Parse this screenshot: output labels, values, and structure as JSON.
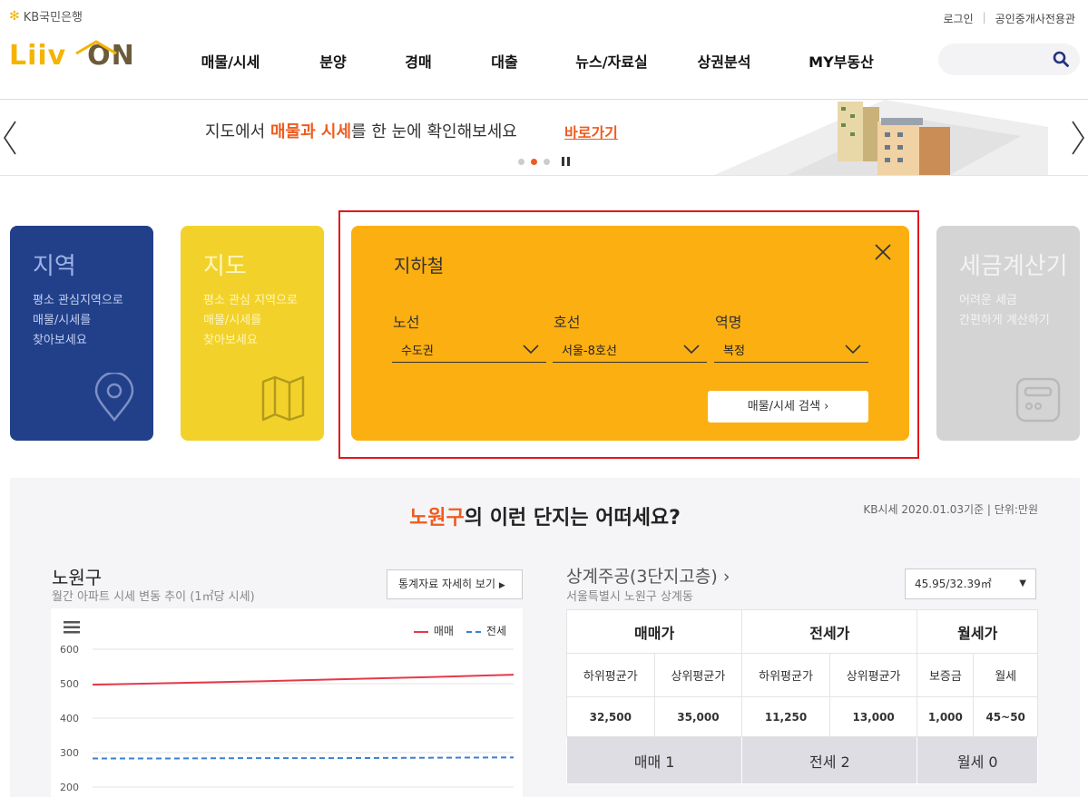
{
  "header": {
    "kb_brand": "KB국민은행",
    "logo_left": "Liiv",
    "logo_right": "ON",
    "login": "로그인",
    "agent": "공인중개사전용관",
    "nav": [
      "매물/시세",
      "분양",
      "경매",
      "대출",
      "뉴스/자료실",
      "상권분석",
      "MY부동산"
    ],
    "search": {
      "value": "",
      "placeholder": ""
    }
  },
  "banner": {
    "text_before": "지도에서 ",
    "text_highlight": "매물과 시세",
    "text_after": "를 한 눈에 확인해보세요",
    "link": "바로가기",
    "active_slide": 2,
    "slide_count": 3
  },
  "cards": {
    "region": {
      "title": "지역",
      "desc": [
        "평소 관심지역으로",
        "매물/시세를",
        "찾아보세요"
      ]
    },
    "map": {
      "title": "지도",
      "desc": [
        "평소 관심 지역으로",
        "매물/시세를",
        "찾아보세요"
      ]
    },
    "subway": {
      "title": "지하철",
      "fields": [
        {
          "label": "노선",
          "value": "수도권"
        },
        {
          "label": "호선",
          "value": "서울-8호선"
        },
        {
          "label": "역명",
          "value": "복정"
        }
      ],
      "button": "매물/시세 검색"
    },
    "tax": {
      "title": "세금계산기",
      "desc": [
        "어려운 세금",
        "간편하게 계산하기"
      ]
    }
  },
  "section": {
    "title_highlight": "노원구",
    "title_rest": "의 이런 단지는 어떠세요?",
    "note": "KB시세 2020.01.03기준 | 단위:만원",
    "region_title": "노원구",
    "region_sub": "월간 아파트 시세 변동 추이 (1㎡당 시세)",
    "stats_button": "통계자료 자세히 보기",
    "apt_title": "상계주공(3단지고층)",
    "apt_sub": "서울특별시 노원구 상계동",
    "area_select": "45.95/32.39㎡",
    "table": {
      "groups": [
        "매매가",
        "전세가",
        "월세가"
      ],
      "sub": [
        "하위평균가",
        "상위평균가",
        "하위평균가",
        "상위평균가",
        "보증금",
        "월세"
      ],
      "values": [
        "32,500",
        "35,000",
        "11,250",
        "13,000",
        "1,000",
        "45~50"
      ],
      "tabs": [
        "매매 1",
        "전세 2",
        "월세 0"
      ]
    }
  },
  "chart_data": {
    "type": "line",
    "x": [
      1,
      2,
      3,
      4,
      5,
      6
    ],
    "series": [
      {
        "name": "매매",
        "values": [
          497,
          502,
          507,
          513,
          519,
          526
        ],
        "color": "#e5394a"
      },
      {
        "name": "전세",
        "values": [
          283,
          283,
          284,
          284,
          285,
          286
        ],
        "color": "#3b7fd4"
      }
    ],
    "ylim": [
      200,
      600
    ],
    "yticks": [
      600,
      500,
      400,
      300,
      200
    ],
    "grid": true,
    "legend": "top-right"
  }
}
